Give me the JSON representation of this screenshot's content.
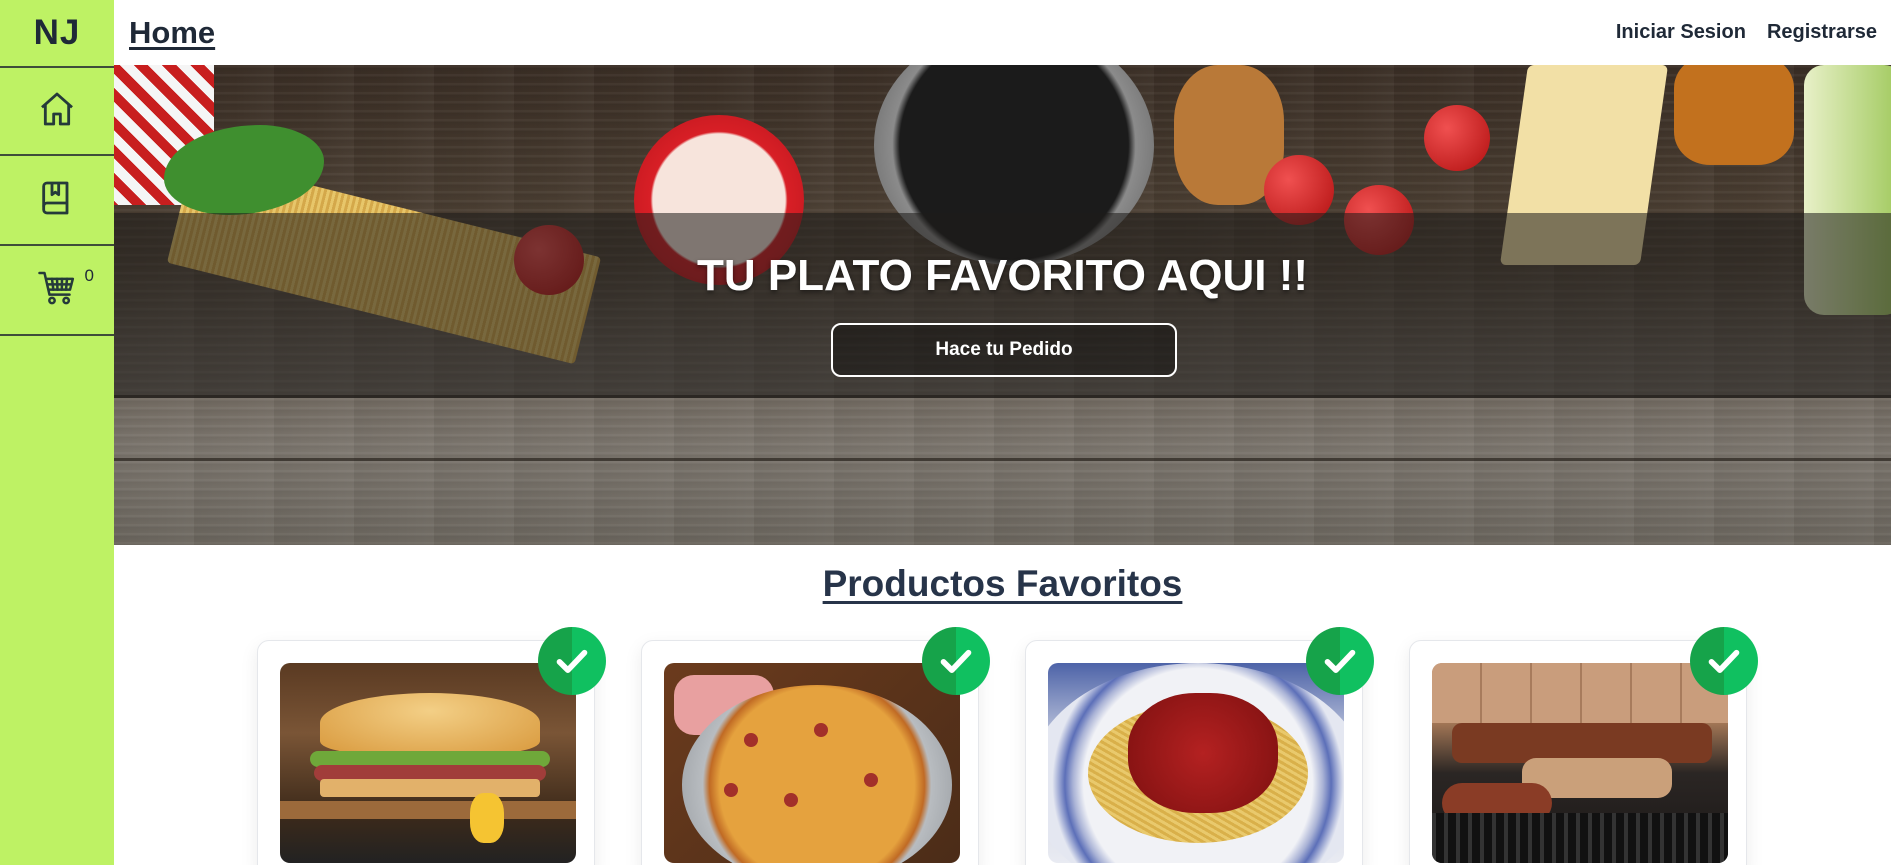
{
  "sidebar": {
    "brand": "NJ",
    "items": [
      {
        "name": "home",
        "icon": "home-icon"
      },
      {
        "name": "menu",
        "icon": "book-icon"
      },
      {
        "name": "cart",
        "icon": "cart-icon",
        "count": "0"
      }
    ],
    "background": "#bef264"
  },
  "topbar": {
    "home_label": "Home",
    "login_label": "Iniciar Sesion",
    "register_label": "Registrarse"
  },
  "hero": {
    "title": "TU PLATO FAVORITO AQUI !!",
    "button_label": "Hace tu Pedido"
  },
  "favorites": {
    "title": "Productos Favoritos",
    "products": [
      {
        "image": "sandwich",
        "badge_icon": "check-icon"
      },
      {
        "image": "pizza",
        "badge_icon": "check-icon"
      },
      {
        "image": "spaghetti",
        "badge_icon": "check-icon"
      },
      {
        "image": "grill-meat",
        "badge_icon": "check-icon"
      }
    ]
  },
  "colors": {
    "accent_green": "#16a34a",
    "text_dark": "#1f2937"
  }
}
